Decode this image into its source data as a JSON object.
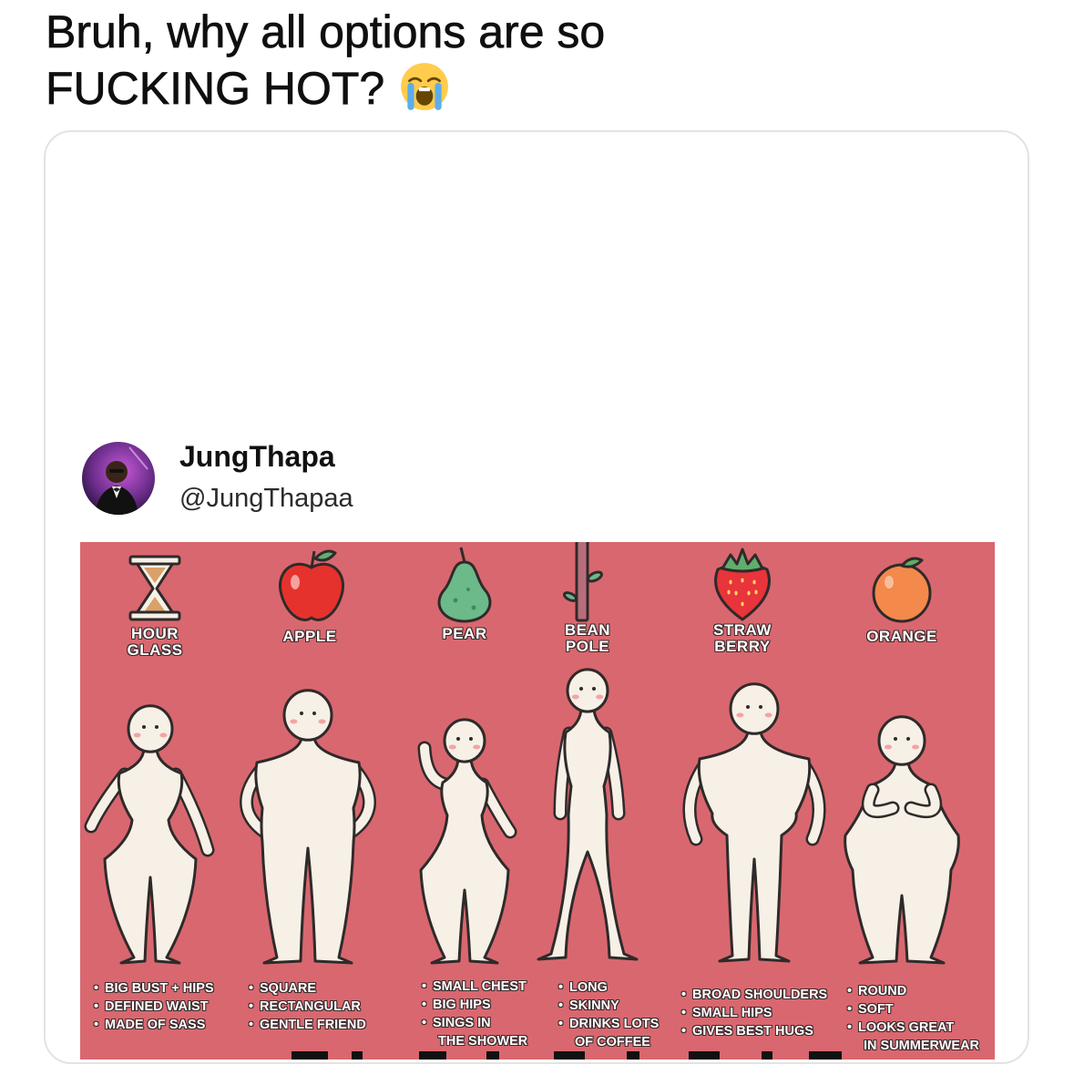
{
  "post": {
    "caption_line1": "Bruh, why all options are so",
    "caption_line2": "FUCKING HOT?",
    "caption_emoji_icon": "loudly-crying-face-icon"
  },
  "embedded_tweet": {
    "display_name": "JungThapa",
    "handle": "@JungThapaa",
    "avatar_icon": "avatar-icon"
  },
  "colors": {
    "panel_background": "#d9676f",
    "figure_fill": "#f6f0e6",
    "figure_outline": "#2f2a2a",
    "card_border": "#e3e3e3"
  },
  "infographic": {
    "columns": [
      {
        "label": [
          "HOUR",
          "GLASS"
        ],
        "icon": "hourglass-icon",
        "bullets": [
          [
            "BIG BUST + HIPS"
          ],
          [
            "DEFINED WAIST"
          ],
          [
            "MADE OF SASS"
          ]
        ]
      },
      {
        "label": [
          "APPLE"
        ],
        "icon": "apple-icon",
        "bullets": [
          [
            "SQUARE"
          ],
          [
            "RECTANGULAR"
          ],
          [
            "GENTLE FRIEND"
          ]
        ]
      },
      {
        "label": [
          "PEAR"
        ],
        "icon": "pear-icon",
        "bullets": [
          [
            "SMALL CHEST"
          ],
          [
            "BIG HIPS"
          ],
          [
            "SINGS IN",
            "THE SHOWER"
          ]
        ]
      },
      {
        "label": [
          "BEAN",
          "POLE"
        ],
        "icon": "bean-pole-icon",
        "bullets": [
          [
            "LONG"
          ],
          [
            "SKINNY"
          ],
          [
            "DRINKS LOTS",
            "OF COFFEE"
          ]
        ]
      },
      {
        "label": [
          "STRAW",
          "BERRY"
        ],
        "icon": "strawberry-icon",
        "bullets": [
          [
            "BROAD SHOULDERS"
          ],
          [
            "SMALL HIPS"
          ],
          [
            "GIVES BEST HUGS"
          ]
        ]
      },
      {
        "label": [
          "ORANGE"
        ],
        "icon": "orange-icon",
        "bullets": [
          [
            "ROUND"
          ],
          [
            "SOFT"
          ],
          [
            "LOOKS GREAT",
            "IN SUMMERWEAR"
          ]
        ]
      }
    ]
  }
}
